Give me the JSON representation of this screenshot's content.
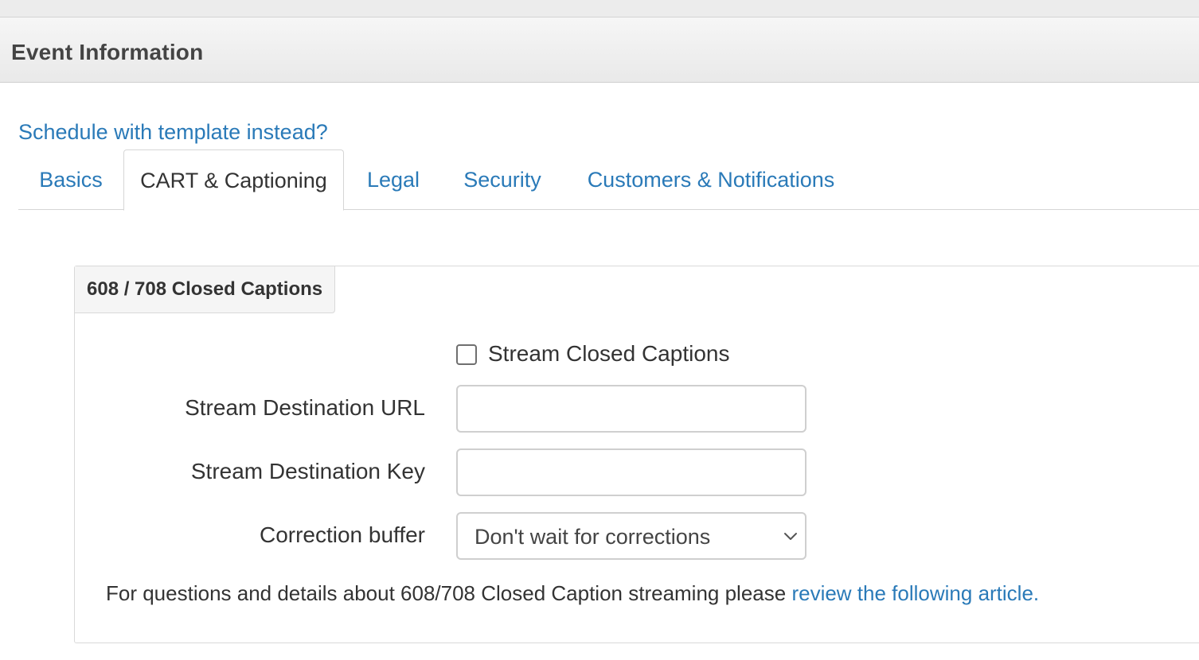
{
  "panel": {
    "title": "Event Information"
  },
  "template_link": "Schedule with template instead?",
  "tabs": [
    {
      "label": "Basics",
      "active": false
    },
    {
      "label": "CART & Captioning",
      "active": true
    },
    {
      "label": "Legal",
      "active": false
    },
    {
      "label": "Security",
      "active": false
    },
    {
      "label": "Customers & Notifications",
      "active": false
    }
  ],
  "section": {
    "legend": "608 / 708 Closed Captions",
    "stream_checkbox": {
      "label": "Stream Closed Captions",
      "checked": false
    },
    "url_field": {
      "label": "Stream Destination URL",
      "value": "",
      "placeholder": ""
    },
    "key_field": {
      "label": "Stream Destination Key",
      "value": "",
      "placeholder": ""
    },
    "buffer_select": {
      "label": "Correction buffer",
      "selected": "Don't wait for corrections"
    },
    "help": {
      "text": "For questions and details about 608/708 Closed Caption streaming please ",
      "link": "review the following article."
    }
  },
  "colors": {
    "link": "#2a7ab8",
    "text": "#333333",
    "border": "#d6d6d6"
  },
  "icons": {
    "select_chevron": "chevron-down-icon"
  }
}
